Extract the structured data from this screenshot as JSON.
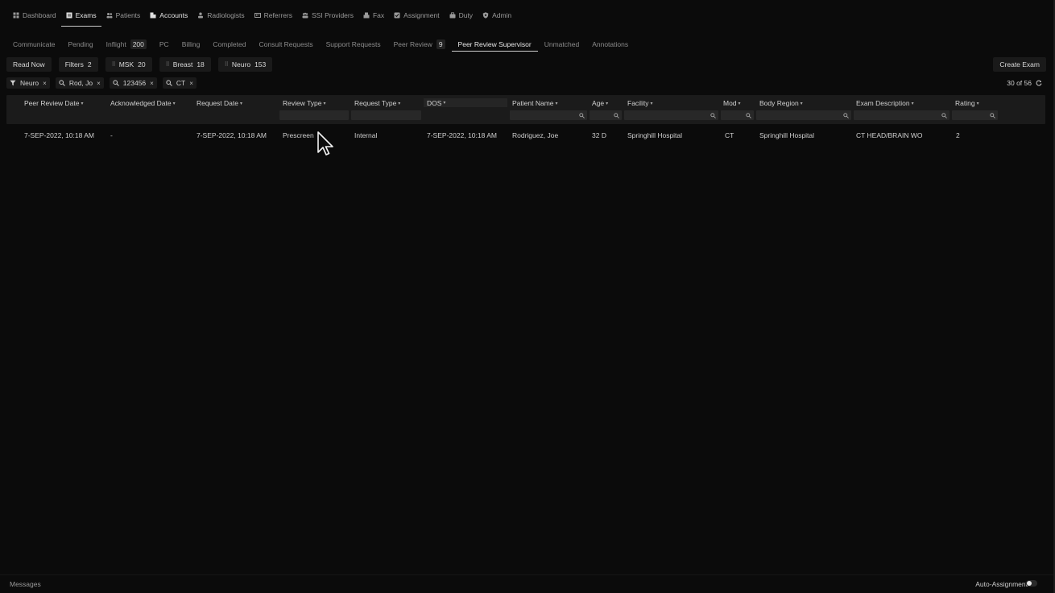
{
  "nav": {
    "items": [
      {
        "label": "Dashboard",
        "icon": "dashboard-icon"
      },
      {
        "label": "Exams",
        "icon": "exams-icon"
      },
      {
        "label": "Patients",
        "icon": "patients-icon"
      },
      {
        "label": "Accounts",
        "icon": "accounts-icon"
      },
      {
        "label": "Radiologists",
        "icon": "radiologists-icon"
      },
      {
        "label": "Referrers",
        "icon": "referrers-icon"
      },
      {
        "label": "SSI Providers",
        "icon": "ssi-providers-icon"
      },
      {
        "label": "Fax",
        "icon": "fax-icon"
      },
      {
        "label": "Assignment",
        "icon": "assignment-icon"
      },
      {
        "label": "Duty",
        "icon": "duty-icon"
      },
      {
        "label": "Admin",
        "icon": "admin-icon"
      }
    ]
  },
  "tabs": {
    "communicate": "Communicate",
    "pending": "Pending",
    "inflight": "Inflight",
    "inflight_count": "200",
    "pc": "PC",
    "billing": "Billing",
    "completed": "Completed",
    "consult": "Consult Requests",
    "support": "Support Requests",
    "peer_review": "Peer Review",
    "peer_review_count": "9",
    "peer_review_supervisor": "Peer Review Supervisor",
    "unmatched": "Unmatched",
    "annotations": "Annotations"
  },
  "actions": {
    "read_now": "Read Now",
    "filters": "Filters",
    "filters_count": "2",
    "msk": "MSK",
    "msk_count": "20",
    "breast": "Breast",
    "breast_count": "18",
    "neuro": "Neuro",
    "neuro_count": "153",
    "create_exam": "Create Exam"
  },
  "chips": {
    "neuro": "Neuro",
    "name": "Rod, Jo",
    "id": "123456",
    "mod": "CT"
  },
  "pager": "30 of 56",
  "columns": {
    "peer_review_date": "Peer Review Date",
    "acknowledged_date": "Acknowledged Date",
    "request_date": "Request Date",
    "review_type": "Review Type",
    "request_type": "Request Type",
    "dos": "DOS",
    "patient_name": "Patient Name",
    "age": "Age",
    "facility": "Facility",
    "mod": "Mod",
    "body_region": "Body Region",
    "exam_description": "Exam Description",
    "rating": "Rating"
  },
  "rows": [
    {
      "peer_review_date": "7-SEP-2022, 10:18 AM",
      "acknowledged_date": "-",
      "request_date": "7-SEP-2022, 10:18 AM",
      "review_type": "Prescreen",
      "request_type": "Internal",
      "dos": "7-SEP-2022, 10:18 AM",
      "patient_name": "Rodriguez, Joe",
      "age": "32 D",
      "facility": "Springhill Hospital",
      "mod": "CT",
      "body_region": "Springhill Hospital",
      "exam_description": "CT HEAD/BRAIN WO",
      "rating": "2"
    }
  ],
  "footer": {
    "messages": "Messages",
    "auto_assignment": "Auto-Assignment"
  }
}
